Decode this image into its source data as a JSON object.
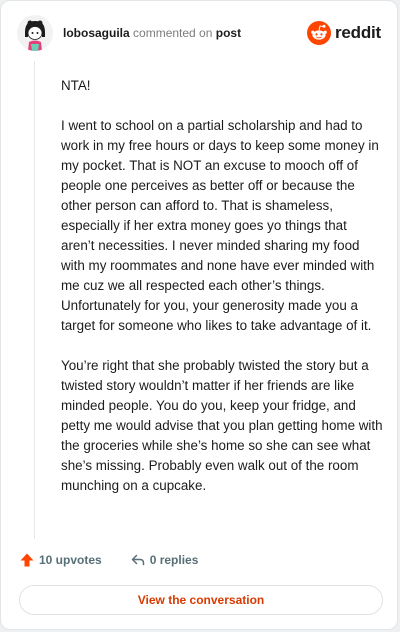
{
  "comment": {
    "username": "lobosaguila",
    "action_text": "commented on",
    "post_link": "post",
    "paragraphs": [
      "NTA!",
      "I went to school on a partial scholarship and had to work in my free hours or days to keep some money in my pocket. That is NOT an excuse to mooch off of people one perceives as better off or because the other person can afford to. That is shameless, especially if her extra money goes yo things that aren’t necessities. I never minded sharing my food with my roommates and none have ever minded with me cuz we all respected each other’s things. Unfortunately for you, your generosity made you a target for someone who likes to take advantage of it.",
      "You’re right that she probably twisted the story but a twisted story wouldn’t matter if her friends are like minded people. You do you, keep your fridge, and petty me would advise that you plan getting home with the groceries while she’s home so she can see what she’s missing. Probably even walk out of the room munching on a cupcake."
    ]
  },
  "brand": {
    "wordmark": "reddit",
    "logo_icon": "reddit-snoo-icon",
    "accent_color": "#ff4500"
  },
  "footer": {
    "upvotes": "10 upvotes",
    "upvote_icon": "upvote-arrow-icon",
    "replies": "0 replies",
    "reply_icon": "reply-arrow-icon"
  },
  "cta": {
    "label": "View the conversation",
    "color": "#d93a00"
  }
}
